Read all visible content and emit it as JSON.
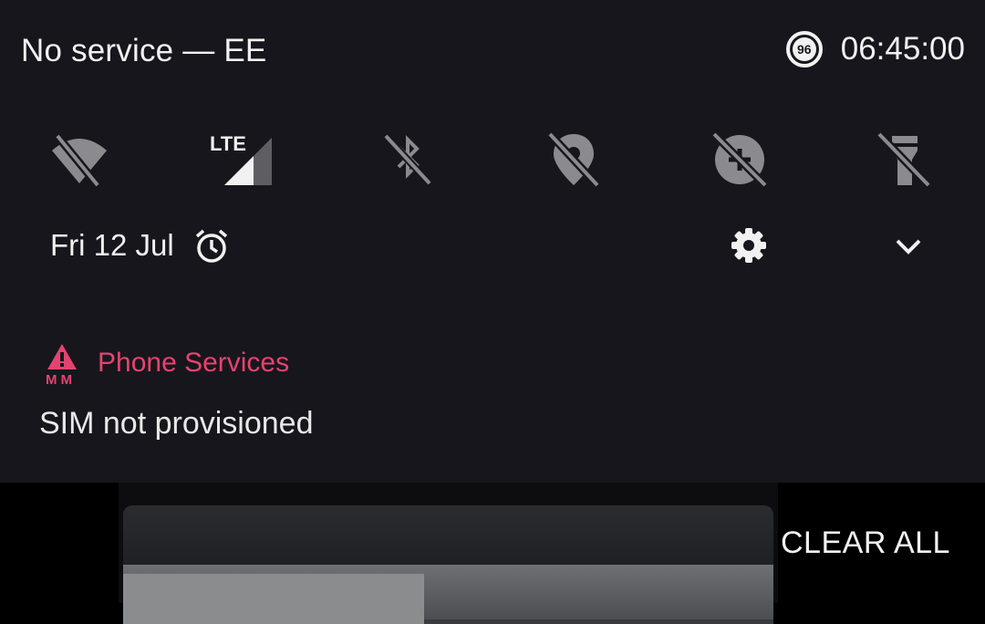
{
  "status_bar": {
    "carrier": "No service — EE",
    "battery_level": "96",
    "clock": "06:45:00"
  },
  "quick_tiles": [
    {
      "name": "wifi-off-icon",
      "state": "off"
    },
    {
      "name": "lte-signal-icon",
      "label": "LTE",
      "state": "on"
    },
    {
      "name": "bluetooth-off-icon",
      "state": "off"
    },
    {
      "name": "location-off-icon",
      "state": "off"
    },
    {
      "name": "data-saver-off-icon",
      "state": "off"
    },
    {
      "name": "flashlight-off-icon",
      "state": "off"
    }
  ],
  "header": {
    "date": "Fri 12 Jul"
  },
  "notification": {
    "app_name": "Phone Services",
    "text": "SIM not provisioned",
    "accent_color": "#e5436f"
  },
  "recents": {
    "clear_all_label": "CLEAR ALL"
  }
}
